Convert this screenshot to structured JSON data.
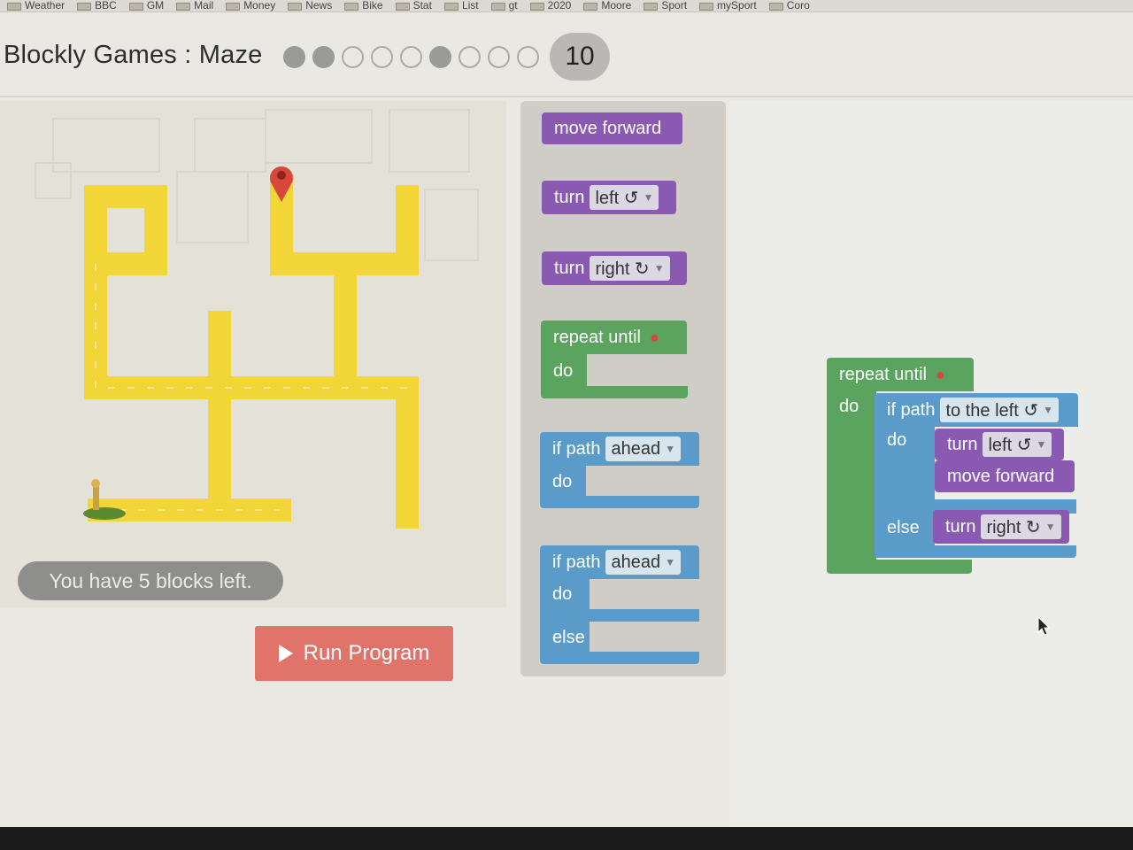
{
  "bookmarks": [
    "Weather",
    "BBC",
    "GM",
    "Mail",
    "Money",
    "News",
    "Bike",
    "Stat",
    "List",
    "gt",
    "2020",
    "Moore",
    "Sport",
    "mySport",
    "Coro"
  ],
  "header": {
    "title": "Blockly Games : Maze",
    "current_level": "10",
    "levels_filled": [
      true,
      true,
      false,
      false,
      false,
      true,
      false,
      false,
      false
    ]
  },
  "status": {
    "blocks_left": "You have 5 blocks left."
  },
  "run_button": {
    "label": "Run Program"
  },
  "toolbox": {
    "move_forward": "move forward",
    "turn_left": {
      "label": "turn",
      "value": "left ↺"
    },
    "turn_right": {
      "label": "turn",
      "value": "right ↻"
    },
    "repeat_until": {
      "label": "repeat until",
      "do": "do"
    },
    "if_path": {
      "label": "if path",
      "value": "ahead",
      "do": "do"
    },
    "if_else_path": {
      "label": "if path",
      "value": "ahead",
      "do": "do",
      "else": "else"
    }
  },
  "workspace": {
    "repeat_label": "repeat until",
    "do_label": "do",
    "if_label": "if path",
    "if_value": "to the left ↺",
    "if_do": "do",
    "turn_left_label": "turn",
    "turn_left_value": "left ↺",
    "move_forward": "move forward",
    "else_label": "else",
    "turn_right_label": "turn",
    "turn_right_value": "right ↻"
  },
  "colors": {
    "motion": "#8a5ab3",
    "loop": "#5aa45f",
    "logic": "#5b9bc9",
    "path": "#f2d537",
    "run": "#e0736a"
  }
}
